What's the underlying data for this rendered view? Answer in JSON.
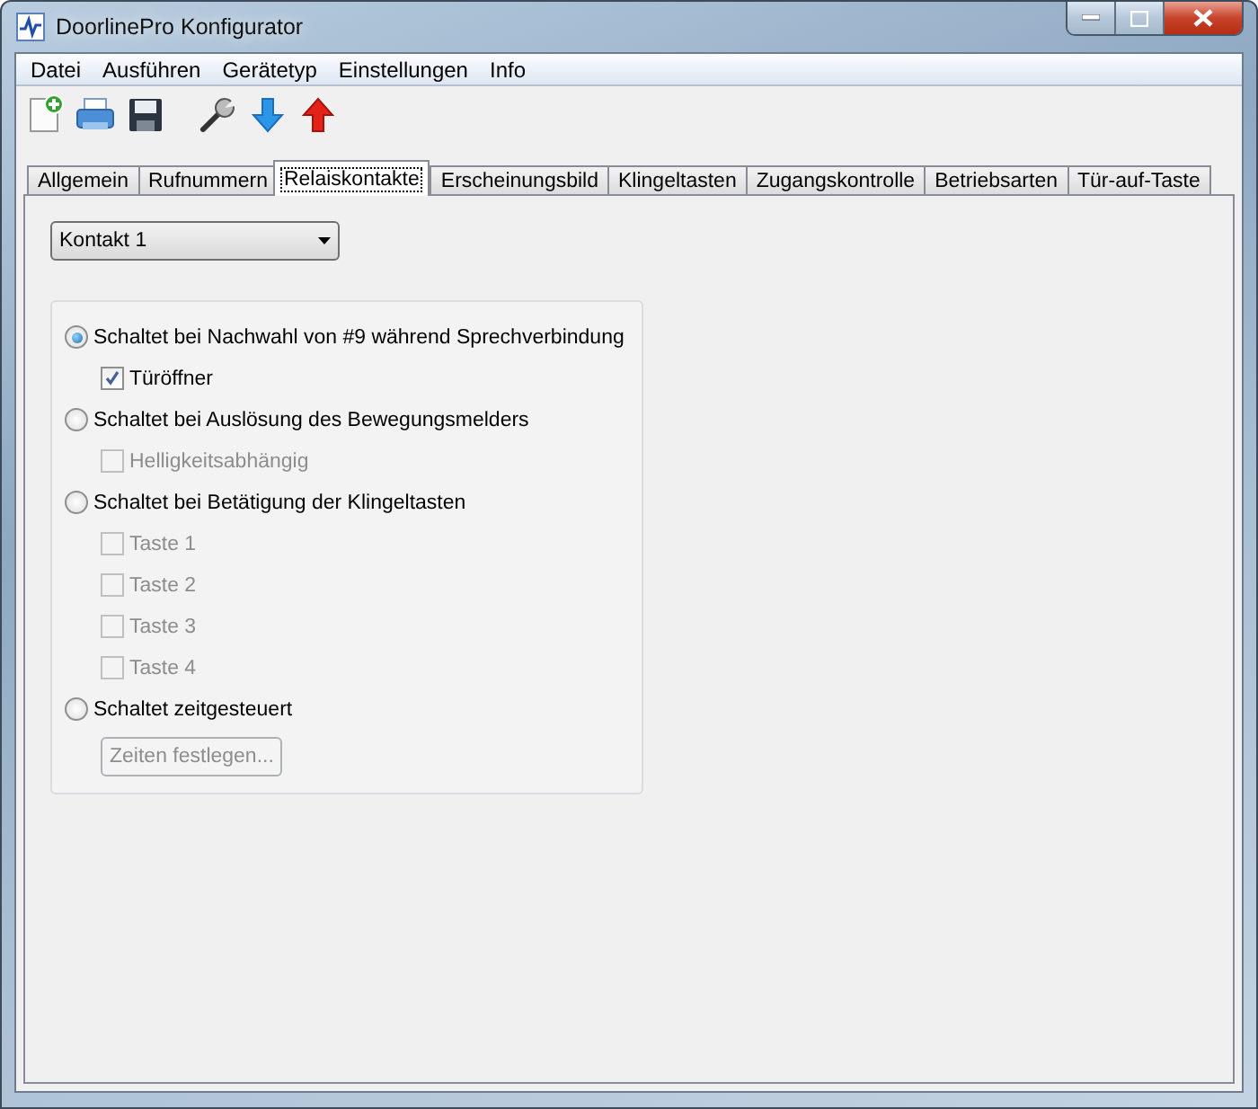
{
  "window": {
    "title": "DoorlinePro Konfigurator"
  },
  "menu": [
    "Datei",
    "Ausführen",
    "Gerätetyp",
    "Einstellungen",
    "Info"
  ],
  "tabs": [
    {
      "label": "Allgemein",
      "selected": false
    },
    {
      "label": "Rufnummern",
      "selected": false
    },
    {
      "label": "Relaiskontakte",
      "selected": true
    },
    {
      "label": "Erscheinungsbild",
      "selected": false
    },
    {
      "label": "Klingeltasten",
      "selected": false
    },
    {
      "label": "Zugangskontrolle",
      "selected": false
    },
    {
      "label": "Betriebsarten",
      "selected": false
    },
    {
      "label": "Tür-auf-Taste",
      "selected": false
    }
  ],
  "contact_select": {
    "value": "Kontakt 1"
  },
  "options": [
    {
      "label": "Schaltet bei Nachwahl von #9 während Sprechverbindung",
      "selected": true,
      "children": [
        {
          "kind": "checkbox",
          "label": "Türöffner",
          "checked": true,
          "disabled": false
        }
      ]
    },
    {
      "label": "Schaltet bei Auslösung des Bewegungsmelders",
      "selected": false,
      "children": [
        {
          "kind": "checkbox",
          "label": "Helligkeitsabhängig",
          "checked": false,
          "disabled": true
        }
      ]
    },
    {
      "label": "Schaltet bei Betätigung der Klingeltasten",
      "selected": false,
      "children": [
        {
          "kind": "checkbox",
          "label": "Taste 1",
          "checked": false,
          "disabled": true
        },
        {
          "kind": "checkbox",
          "label": "Taste 2",
          "checked": false,
          "disabled": true
        },
        {
          "kind": "checkbox",
          "label": "Taste 3",
          "checked": false,
          "disabled": true
        },
        {
          "kind": "checkbox",
          "label": "Taste 4",
          "checked": false,
          "disabled": true
        }
      ]
    },
    {
      "label": "Schaltet zeitgesteuert",
      "selected": false,
      "children": [
        {
          "kind": "button",
          "label": "Zeiten festlegen...",
          "disabled": true
        }
      ]
    }
  ]
}
